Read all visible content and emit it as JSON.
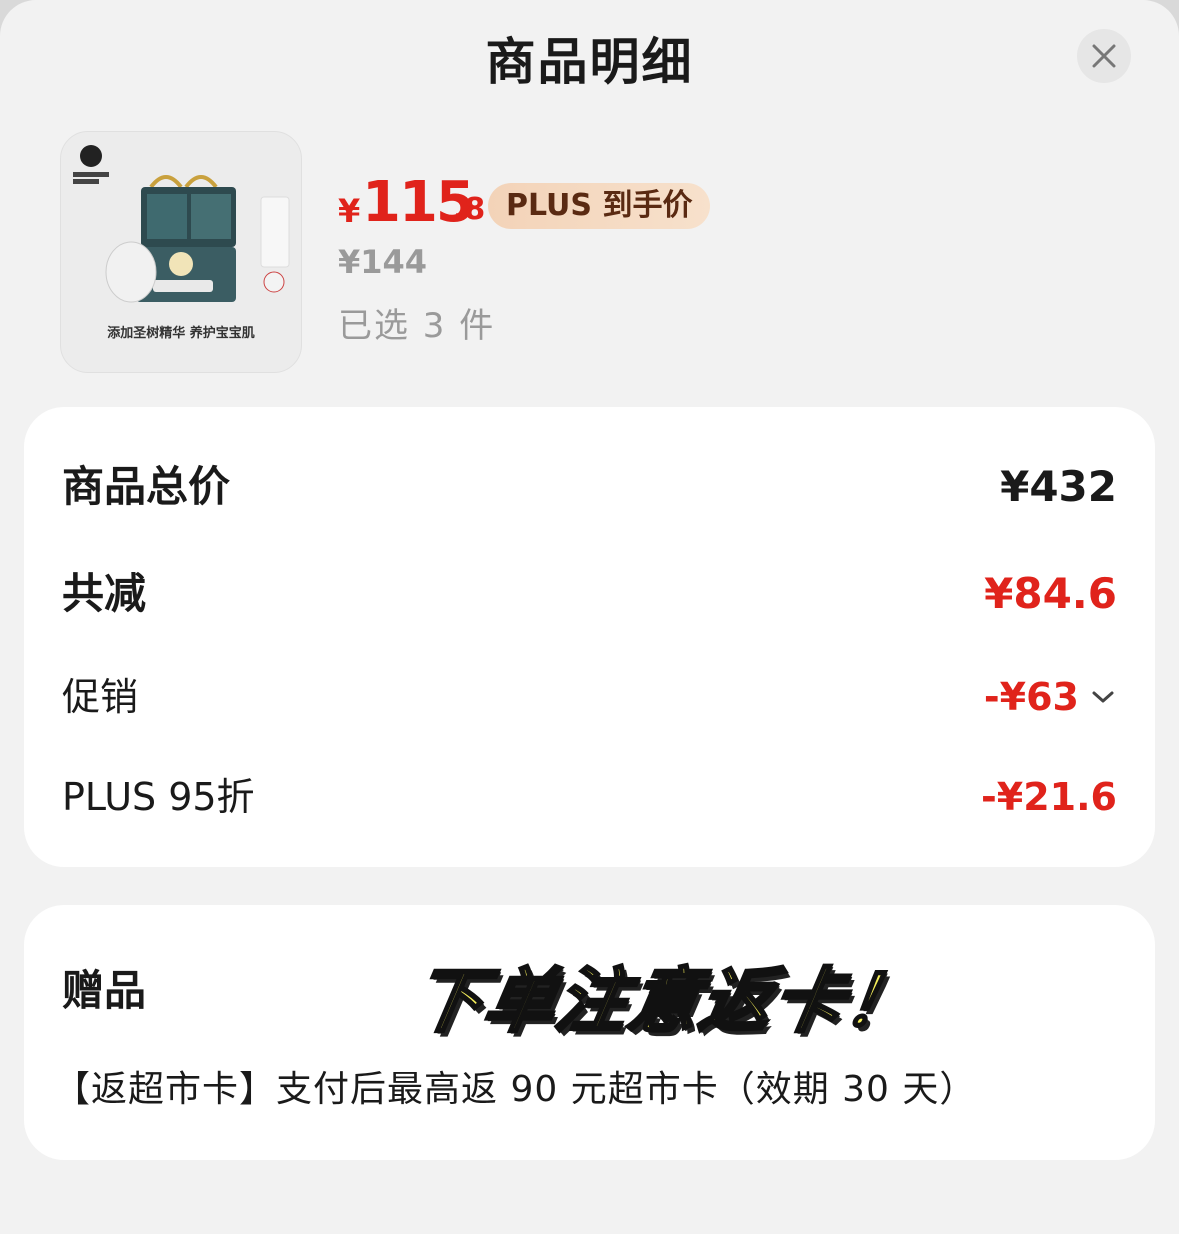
{
  "sheet": {
    "title": "商品明细"
  },
  "product": {
    "image_caption": "添加圣树精华 养护宝宝肌",
    "price_currency": "¥",
    "price_integer": "115",
    "price_decimal": ".8",
    "plus_badge": "PLUS 到手价",
    "original_price": "¥144",
    "selected_qty": "已选 3 件"
  },
  "summary": {
    "total_label": "商品总价",
    "total_value": "¥432",
    "discount_label": "共减",
    "discount_value": "¥84.6",
    "promo_label": "促销",
    "promo_value": "-¥63",
    "plus_label": "PLUS 95折",
    "plus_value": "-¥21.6"
  },
  "gift": {
    "label": "赠品",
    "description": "【返超市卡】支付后最高返 90 元超市卡（效期 30 天）",
    "overlay_text": "下单注意返卡！"
  },
  "colors": {
    "accent_red": "#e0231b",
    "plus_badge_bg": "#f3d3b8",
    "stamp_yellow": "#f6ef5a"
  },
  "icons": {
    "close": "close-icon",
    "expand": "chevron-down-icon"
  }
}
